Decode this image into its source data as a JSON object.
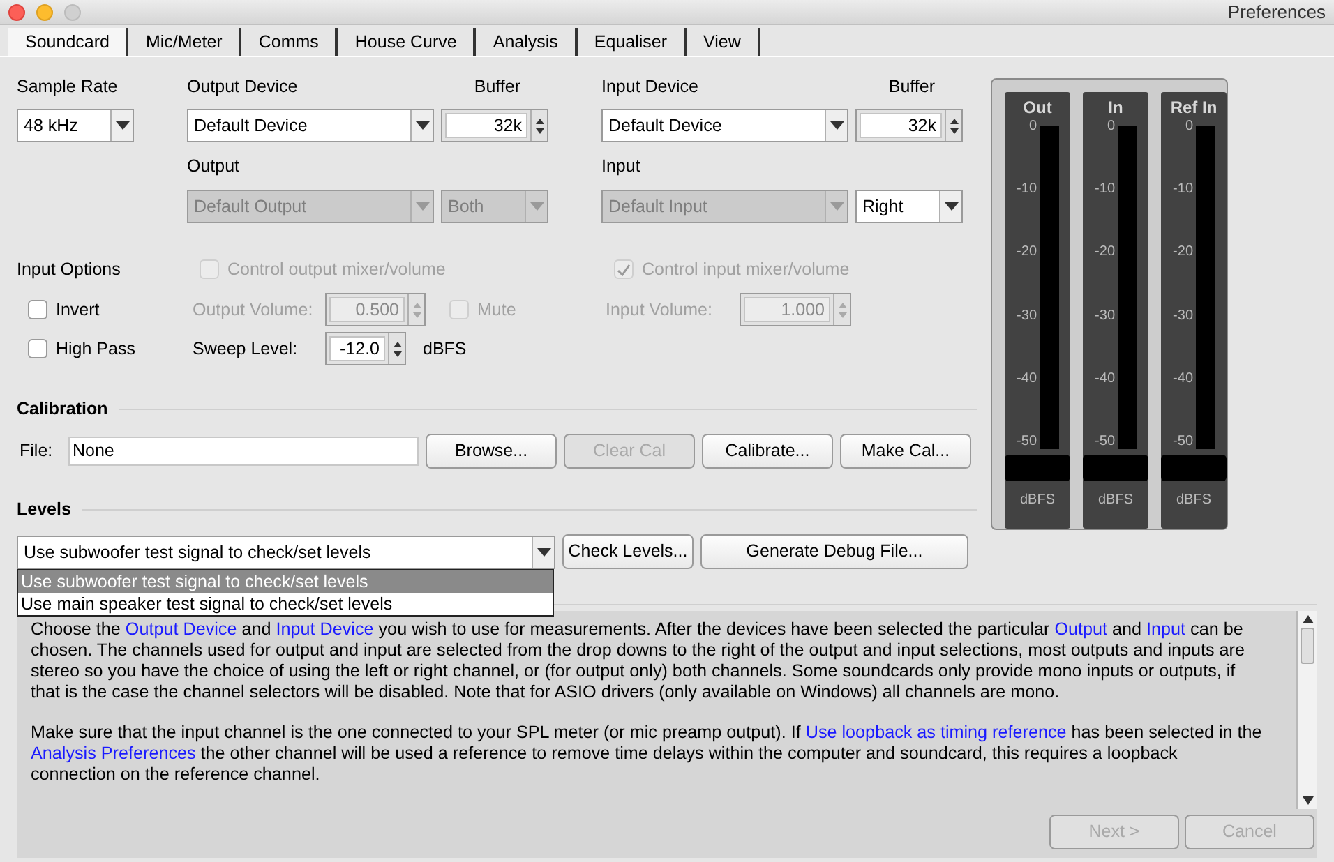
{
  "window": {
    "title": "Preferences"
  },
  "tabs": [
    {
      "label": "Soundcard",
      "selected": true
    },
    {
      "label": "Mic/Meter",
      "selected": false
    },
    {
      "label": "Comms",
      "selected": false
    },
    {
      "label": "House Curve",
      "selected": false
    },
    {
      "label": "Analysis",
      "selected": false
    },
    {
      "label": "Equaliser",
      "selected": false
    },
    {
      "label": "View",
      "selected": false
    }
  ],
  "devices": {
    "sample_rate": {
      "label": "Sample Rate",
      "value": "48 kHz"
    },
    "output_device": {
      "label": "Output Device",
      "value": "Default Device"
    },
    "output_buffer": {
      "label": "Buffer",
      "value": "32k"
    },
    "input_device": {
      "label": "Input Device",
      "value": "Default Device"
    },
    "input_buffer": {
      "label": "Buffer",
      "value": "32k"
    },
    "output_label": "Output",
    "output_channel": {
      "value": "Default Output",
      "disabled": true
    },
    "output_mode": {
      "value": "Both",
      "disabled": true
    },
    "input_label": "Input",
    "input_channel": {
      "value": "Default Input",
      "disabled": true
    },
    "input_mode": {
      "value": "Right",
      "disabled": false
    }
  },
  "input_options": {
    "label": "Input Options",
    "invert": {
      "label": "Invert",
      "checked": false,
      "disabled": false
    },
    "high_pass": {
      "label": "High Pass",
      "checked": false,
      "disabled": false
    }
  },
  "control_output": {
    "label": "Control output mixer/volume",
    "checked": false,
    "disabled": true
  },
  "control_input": {
    "label": "Control input mixer/volume",
    "checked": true,
    "disabled": true
  },
  "output_volume": {
    "label": "Output Volume:",
    "value": "0.500",
    "disabled": true
  },
  "mute": {
    "label": "Mute",
    "checked": false,
    "disabled": true
  },
  "input_volume": {
    "label": "Input Volume:",
    "value": "1.000",
    "disabled": true
  },
  "sweep_level": {
    "label": "Sweep Level:",
    "value": "-12.0",
    "unit": "dBFS",
    "disabled": false
  },
  "calibration": {
    "title": "Calibration",
    "file_label": "File:",
    "file_value": "None",
    "buttons": [
      {
        "label": "Browse...",
        "disabled": false
      },
      {
        "label": "Clear Cal",
        "disabled": true
      },
      {
        "label": "Calibrate...",
        "disabled": false
      },
      {
        "label": "Make Cal...",
        "disabled": false
      }
    ]
  },
  "levels": {
    "title": "Levels",
    "value": "Use subwoofer test signal to check/set levels",
    "buttons": [
      {
        "label": "Check Levels...",
        "disabled": false
      },
      {
        "label": "Generate Debug File...",
        "disabled": false
      }
    ],
    "options": [
      {
        "label": "Use subwoofer test signal to check/set levels",
        "selected": true
      },
      {
        "label": "Use main speaker test signal to check/set levels",
        "selected": false
      }
    ]
  },
  "meters": [
    {
      "label": "Out",
      "scale": [
        "0",
        "-10",
        "-20",
        "-30",
        "-40",
        "-50"
      ],
      "unit": "dBFS"
    },
    {
      "label": "In",
      "scale": [
        "0",
        "-10",
        "-20",
        "-30",
        "-40",
        "-50"
      ],
      "unit": "dBFS"
    },
    {
      "label": "Ref In",
      "scale": [
        "0",
        "-10",
        "-20",
        "-30",
        "-40",
        "-50"
      ],
      "unit": "dBFS"
    }
  ],
  "help": {
    "paragraphs": [
      [
        {
          "text": "Choose the ",
          "kind": "plain"
        },
        {
          "text": "Output Device",
          "kind": "link"
        },
        {
          "text": " and ",
          "kind": "plain"
        },
        {
          "text": "Input Device",
          "kind": "link"
        },
        {
          "text": " you wish to use for measurements. After the devices have been selected the particular ",
          "kind": "plain"
        },
        {
          "text": "Output",
          "kind": "link"
        },
        {
          "text": " and ",
          "kind": "plain"
        },
        {
          "text": "Input",
          "kind": "link"
        },
        {
          "text": " can be chosen. The channels used for output and input are selected from the drop downs to the right of the output and input selections, most outputs and inputs are stereo so you have the choice of using the left or right channel, or (for output only) both channels. Some soundcards only provide mono inputs or outputs, if that is the case the channel selectors will be disabled. Note that for ASIO drivers (only available on Windows) all channels are mono.",
          "kind": "plain"
        }
      ],
      [
        {
          "text": "Make sure that the input channel is the one connected to your SPL meter (or mic preamp output). If ",
          "kind": "plain"
        },
        {
          "text": "Use loopback as timing reference",
          "kind": "link"
        },
        {
          "text": " has been selected in the ",
          "kind": "plain"
        },
        {
          "text": "Analysis Preferences",
          "kind": "link"
        },
        {
          "text": " the other channel will be used a reference to remove time delays within the computer and soundcard, this requires a loopback connection on the reference channel.",
          "kind": "plain"
        }
      ]
    ]
  },
  "footer_buttons": [
    {
      "label": "Next >",
      "disabled": true
    },
    {
      "label": "Cancel",
      "disabled": true
    }
  ]
}
